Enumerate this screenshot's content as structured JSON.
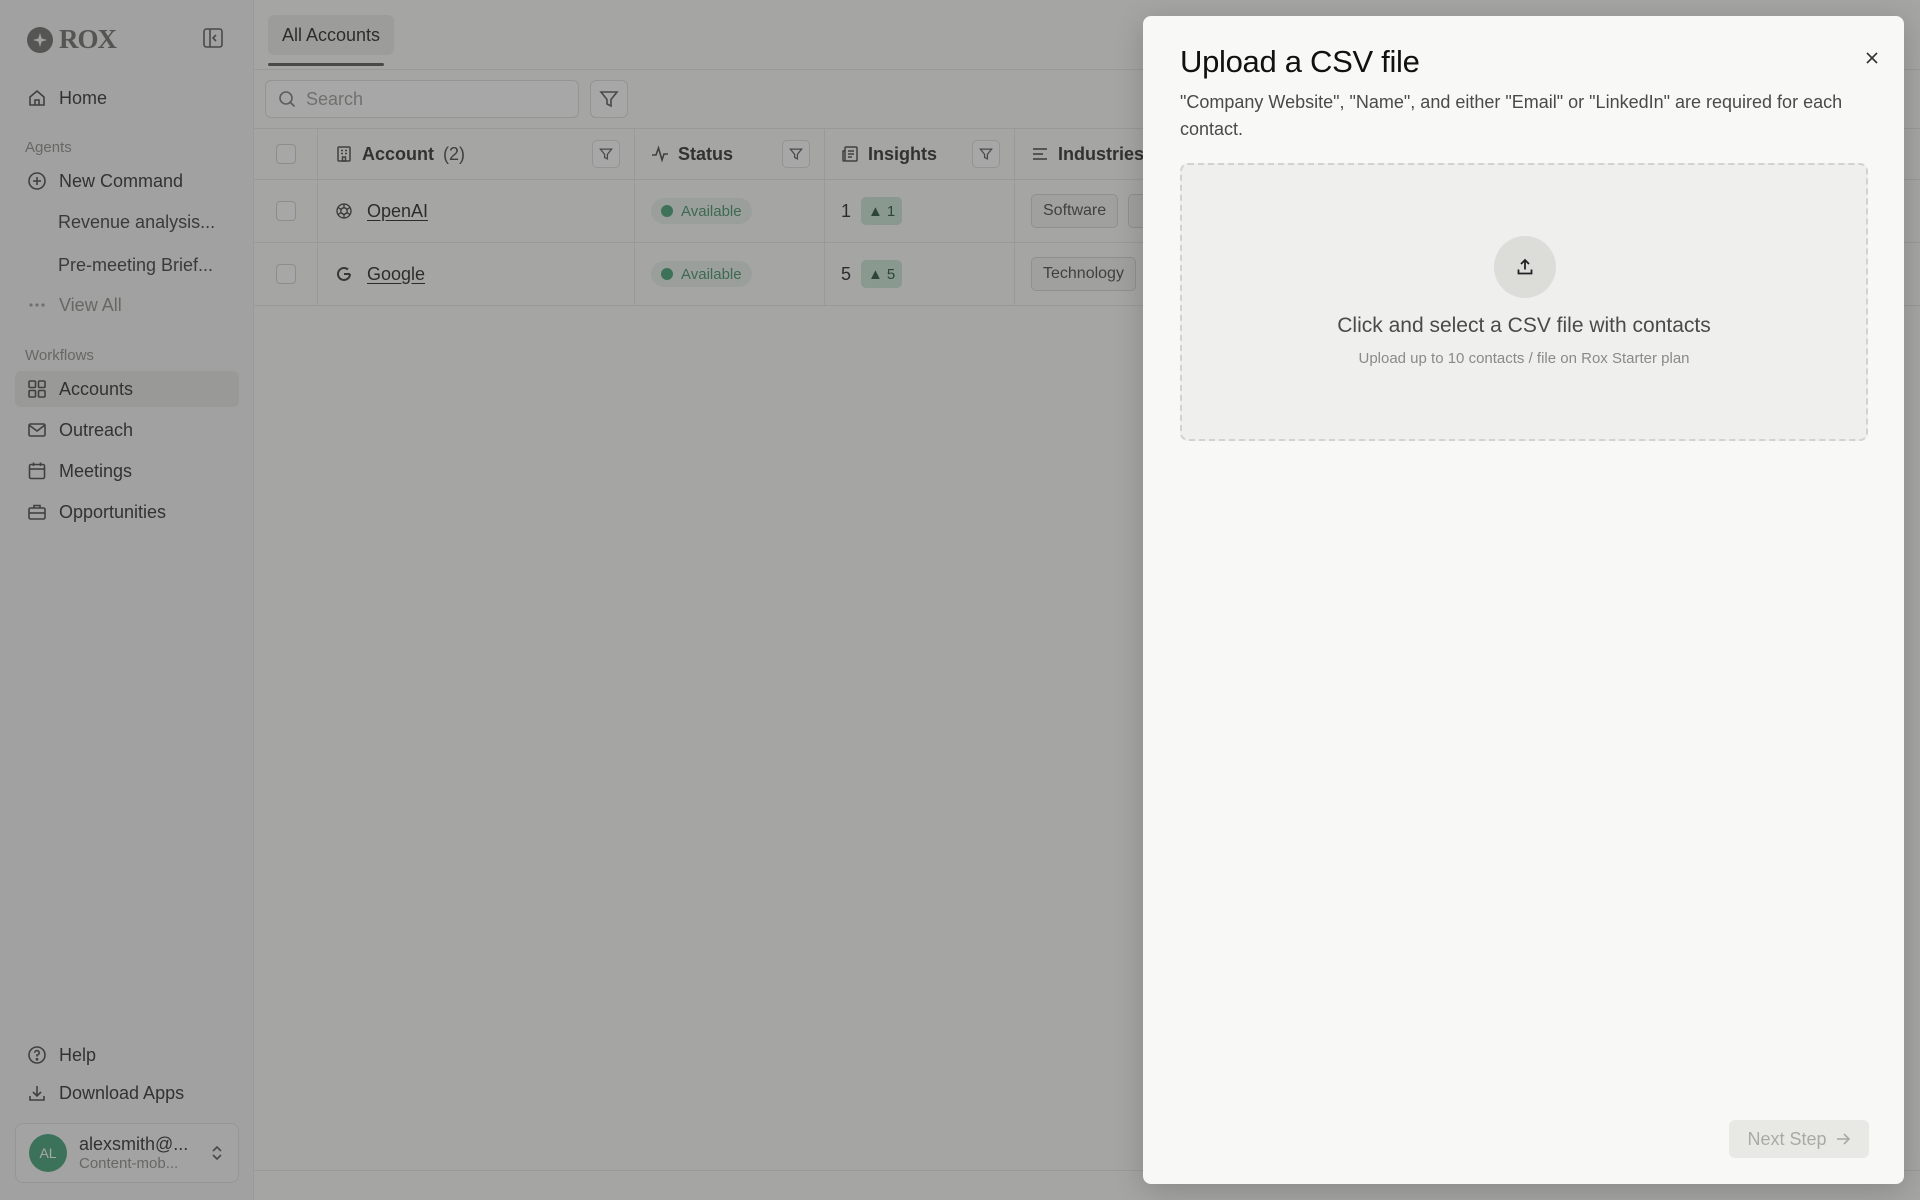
{
  "brand": {
    "name": "ROX"
  },
  "sidebar": {
    "home": "Home",
    "agents_label": "Agents",
    "agents": [
      {
        "label": "New Command",
        "icon": "plus-circle-icon"
      },
      {
        "label": "Revenue analysis..."
      },
      {
        "label": "Pre-meeting Brief..."
      },
      {
        "label": "View All",
        "icon": "ellipsis-icon"
      }
    ],
    "workflows_label": "Workflows",
    "workflows": [
      {
        "label": "Accounts",
        "icon": "grid-icon",
        "active": true
      },
      {
        "label": "Outreach",
        "icon": "mail-icon"
      },
      {
        "label": "Meetings",
        "icon": "calendar-icon"
      },
      {
        "label": "Opportunities",
        "icon": "briefcase-icon"
      }
    ],
    "help": "Help",
    "download": "Download Apps",
    "user": {
      "initials": "AL",
      "email": "alexsmith@...",
      "org": "Content-mob..."
    }
  },
  "main": {
    "tab": "All Accounts",
    "search_placeholder": "Search",
    "columns": {
      "account": "Account",
      "account_count": "(2)",
      "status": "Status",
      "insights": "Insights",
      "industries": "Industries"
    },
    "rows": [
      {
        "name": "OpenAI",
        "status": "Available",
        "insights": "1",
        "insights_up": "1",
        "industries": [
          "Software"
        ]
      },
      {
        "name": "Google",
        "status": "Available",
        "insights": "5",
        "insights_up": "5",
        "industries": [
          "Technology"
        ]
      }
    ]
  },
  "modal": {
    "title": "Upload a CSV file",
    "description": "\"Company Website\", \"Name\", and either \"Email\" or \"LinkedIn\" are required for each contact.",
    "drop_title": "Click and select a CSV file with contacts",
    "drop_subtitle": "Upload up to 10 contacts / file on Rox Starter plan",
    "next_button": "Next Step"
  },
  "colors": {
    "accent_green": "#3f9f6f",
    "overlay": "rgba(60,60,60,0.45)"
  }
}
